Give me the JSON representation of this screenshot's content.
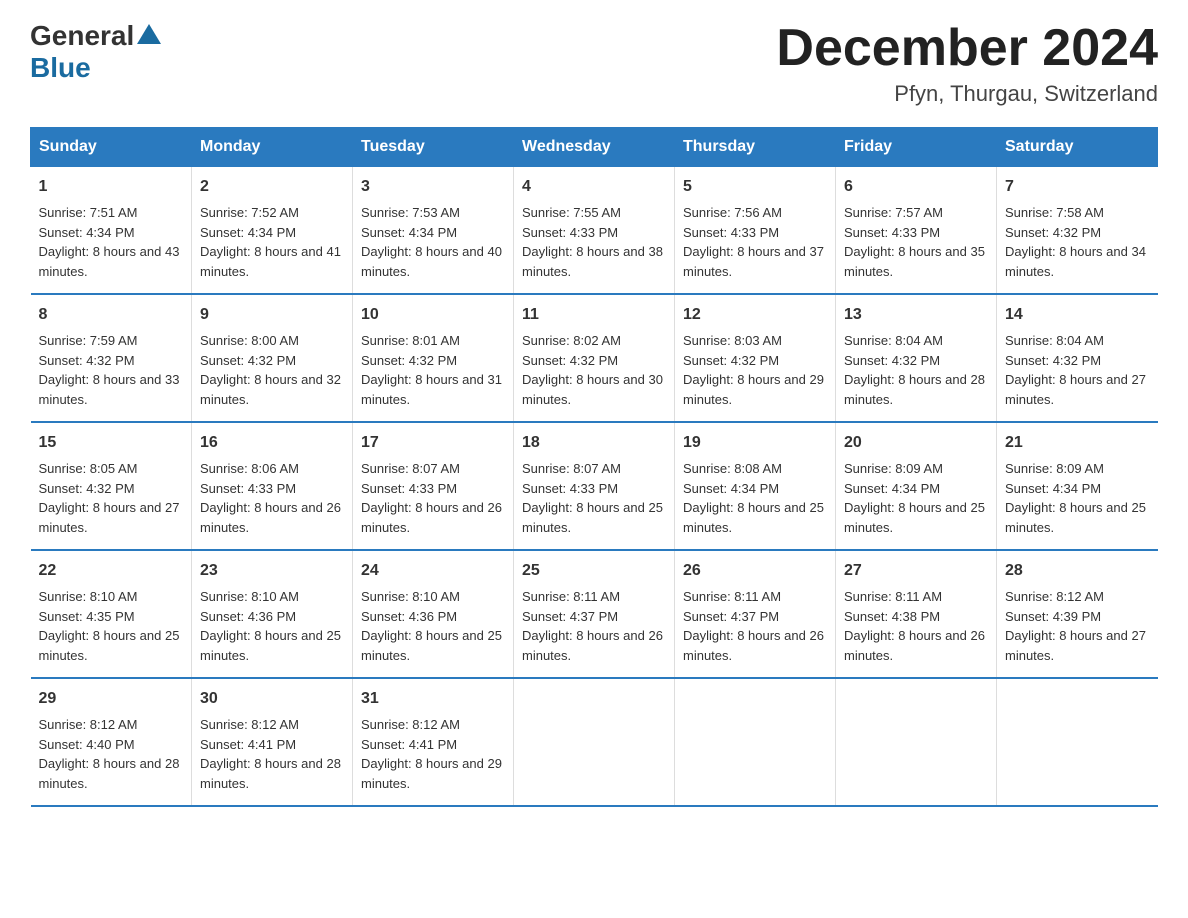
{
  "logo": {
    "general": "General",
    "blue": "Blue"
  },
  "title": "December 2024",
  "location": "Pfyn, Thurgau, Switzerland",
  "headers": [
    "Sunday",
    "Monday",
    "Tuesday",
    "Wednesday",
    "Thursday",
    "Friday",
    "Saturday"
  ],
  "weeks": [
    [
      {
        "day": "1",
        "sunrise": "7:51 AM",
        "sunset": "4:34 PM",
        "daylight": "8 hours and 43 minutes."
      },
      {
        "day": "2",
        "sunrise": "7:52 AM",
        "sunset": "4:34 PM",
        "daylight": "8 hours and 41 minutes."
      },
      {
        "day": "3",
        "sunrise": "7:53 AM",
        "sunset": "4:34 PM",
        "daylight": "8 hours and 40 minutes."
      },
      {
        "day": "4",
        "sunrise": "7:55 AM",
        "sunset": "4:33 PM",
        "daylight": "8 hours and 38 minutes."
      },
      {
        "day": "5",
        "sunrise": "7:56 AM",
        "sunset": "4:33 PM",
        "daylight": "8 hours and 37 minutes."
      },
      {
        "day": "6",
        "sunrise": "7:57 AM",
        "sunset": "4:33 PM",
        "daylight": "8 hours and 35 minutes."
      },
      {
        "day": "7",
        "sunrise": "7:58 AM",
        "sunset": "4:32 PM",
        "daylight": "8 hours and 34 minutes."
      }
    ],
    [
      {
        "day": "8",
        "sunrise": "7:59 AM",
        "sunset": "4:32 PM",
        "daylight": "8 hours and 33 minutes."
      },
      {
        "day": "9",
        "sunrise": "8:00 AM",
        "sunset": "4:32 PM",
        "daylight": "8 hours and 32 minutes."
      },
      {
        "day": "10",
        "sunrise": "8:01 AM",
        "sunset": "4:32 PM",
        "daylight": "8 hours and 31 minutes."
      },
      {
        "day": "11",
        "sunrise": "8:02 AM",
        "sunset": "4:32 PM",
        "daylight": "8 hours and 30 minutes."
      },
      {
        "day": "12",
        "sunrise": "8:03 AM",
        "sunset": "4:32 PM",
        "daylight": "8 hours and 29 minutes."
      },
      {
        "day": "13",
        "sunrise": "8:04 AM",
        "sunset": "4:32 PM",
        "daylight": "8 hours and 28 minutes."
      },
      {
        "day": "14",
        "sunrise": "8:04 AM",
        "sunset": "4:32 PM",
        "daylight": "8 hours and 27 minutes."
      }
    ],
    [
      {
        "day": "15",
        "sunrise": "8:05 AM",
        "sunset": "4:32 PM",
        "daylight": "8 hours and 27 minutes."
      },
      {
        "day": "16",
        "sunrise": "8:06 AM",
        "sunset": "4:33 PM",
        "daylight": "8 hours and 26 minutes."
      },
      {
        "day": "17",
        "sunrise": "8:07 AM",
        "sunset": "4:33 PM",
        "daylight": "8 hours and 26 minutes."
      },
      {
        "day": "18",
        "sunrise": "8:07 AM",
        "sunset": "4:33 PM",
        "daylight": "8 hours and 25 minutes."
      },
      {
        "day": "19",
        "sunrise": "8:08 AM",
        "sunset": "4:34 PM",
        "daylight": "8 hours and 25 minutes."
      },
      {
        "day": "20",
        "sunrise": "8:09 AM",
        "sunset": "4:34 PM",
        "daylight": "8 hours and 25 minutes."
      },
      {
        "day": "21",
        "sunrise": "8:09 AM",
        "sunset": "4:34 PM",
        "daylight": "8 hours and 25 minutes."
      }
    ],
    [
      {
        "day": "22",
        "sunrise": "8:10 AM",
        "sunset": "4:35 PM",
        "daylight": "8 hours and 25 minutes."
      },
      {
        "day": "23",
        "sunrise": "8:10 AM",
        "sunset": "4:36 PM",
        "daylight": "8 hours and 25 minutes."
      },
      {
        "day": "24",
        "sunrise": "8:10 AM",
        "sunset": "4:36 PM",
        "daylight": "8 hours and 25 minutes."
      },
      {
        "day": "25",
        "sunrise": "8:11 AM",
        "sunset": "4:37 PM",
        "daylight": "8 hours and 26 minutes."
      },
      {
        "day": "26",
        "sunrise": "8:11 AM",
        "sunset": "4:37 PM",
        "daylight": "8 hours and 26 minutes."
      },
      {
        "day": "27",
        "sunrise": "8:11 AM",
        "sunset": "4:38 PM",
        "daylight": "8 hours and 26 minutes."
      },
      {
        "day": "28",
        "sunrise": "8:12 AM",
        "sunset": "4:39 PM",
        "daylight": "8 hours and 27 minutes."
      }
    ],
    [
      {
        "day": "29",
        "sunrise": "8:12 AM",
        "sunset": "4:40 PM",
        "daylight": "8 hours and 28 minutes."
      },
      {
        "day": "30",
        "sunrise": "8:12 AM",
        "sunset": "4:41 PM",
        "daylight": "8 hours and 28 minutes."
      },
      {
        "day": "31",
        "sunrise": "8:12 AM",
        "sunset": "4:41 PM",
        "daylight": "8 hours and 29 minutes."
      },
      null,
      null,
      null,
      null
    ]
  ]
}
